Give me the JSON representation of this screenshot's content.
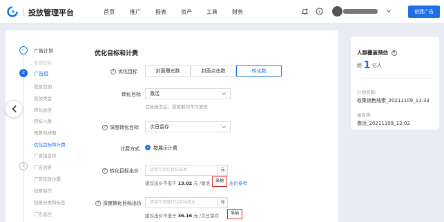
{
  "header": {
    "brand": "投放管理平台",
    "nav": [
      "首页",
      "推广",
      "报表",
      "资产",
      "工具",
      "财务"
    ],
    "create_button": "创建广告",
    "icons": [
      "bell-icon",
      "help-icon",
      "user-avatar",
      "chevron-down-icon"
    ]
  },
  "steps": {
    "group1": {
      "num": "✓",
      "title": "广告计划",
      "items": [
        "营销目标"
      ]
    },
    "group2": {
      "num": "2",
      "title": "广告组",
      "items": [
        "投放范围",
        "投放类型",
        "转化途径",
        "目标人群",
        "预算和排期",
        "优化目标和计费",
        "广告组名称"
      ]
    },
    "group3": {
      "num": "3",
      "title": "广告创意",
      "items": [
        "广告投放位置",
        "创意制作",
        "创意分类和标签",
        "广告监控"
      ]
    }
  },
  "form": {
    "section_title": "优化目标和计费",
    "optimize_label": "优化目标",
    "optimize_options": [
      "封面曝光数",
      "封面点击数",
      "转化数"
    ],
    "optimize_selected": "转化数",
    "conv_target_label": "转化目标",
    "conv_target_value": "激活",
    "conv_target_hint": "目标选定后，投放期间不可更改",
    "deep_conv_label": "深度转化目标",
    "deep_conv_value": "次日留存",
    "billing_label": "计费方式",
    "billing_value": "按展示计费",
    "conv_bid_label": "转化目标出价",
    "conv_bid_placeholder": "请填写转化目标成本",
    "conv_bid_unit": "元",
    "conv_bid_sugg_prefix": "建议出价不低于",
    "conv_bid_sugg_value": "13.02",
    "conv_bid_sugg_suffix": "元 /激活",
    "conv_bid_adopt": "采纳",
    "conv_bid_link": "出价参考",
    "deep_bid_label": "深度转化目标出价",
    "deep_bid_placeholder": "请填写深度转化目标成本",
    "deep_bid_unit": "元",
    "deep_bid_sugg_prefix": "建议出价不低于",
    "deep_bid_sugg_value": "36.16",
    "deep_bid_sugg_suffix": "元 /次日留存",
    "deep_bid_adopt": "采纳"
  },
  "estimate": {
    "title": "人群覆盖预估",
    "prefix": "超",
    "number": "1",
    "unit": "亿人",
    "plan_label": "计划名称:",
    "plan_value": "收集销售线索_20211109_11:33",
    "group_label": "组名称:",
    "group_value": "激活_20211109_12:02"
  },
  "colors": {
    "accent": "#1f6fe5",
    "highlight": "#e02020"
  }
}
